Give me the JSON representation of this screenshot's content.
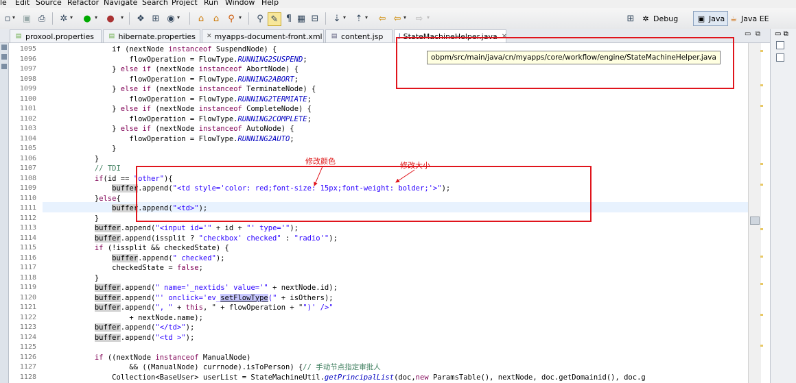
{
  "menu": [
    "le",
    "Edit",
    "Source",
    "Refactor",
    "Navigate",
    "Search",
    "Project",
    "Run",
    "Window",
    "Help"
  ],
  "perspectives": [
    {
      "label": "Debug",
      "icon": "debug-perspective-icon",
      "active": false
    },
    {
      "label": "Java",
      "icon": "java-perspective-icon",
      "active": true
    },
    {
      "label": "Java EE",
      "icon": "javaee-perspective-icon",
      "active": false
    }
  ],
  "tabs": [
    {
      "label": "proxool.properties",
      "icon": "properties-file-icon",
      "active": false
    },
    {
      "label": "hibernate.properties",
      "icon": "properties-file-icon",
      "active": false
    },
    {
      "label": "myapps-document-front.xml",
      "icon": "xml-file-icon",
      "active": false
    },
    {
      "label": "content.jsp",
      "icon": "jsp-file-icon",
      "active": false
    },
    {
      "label": "StateMachineHelper.java",
      "icon": "java-file-icon",
      "active": true
    }
  ],
  "tooltip": "obpm/src/main/java/cn/myapps/core/workflow/engine/StateMachineHelper.java",
  "annotations": {
    "color_note": "修改颜色",
    "size_note": "修改大小"
  },
  "code": {
    "lines": [
      {
        "num": "1095",
        "parts": [
          {
            "t": "                if (nextNode ",
            "c": ""
          },
          {
            "t": "instanceof",
            "c": "kw"
          },
          {
            "t": " SuspendNode) {",
            "c": ""
          }
        ]
      },
      {
        "num": "1096",
        "parts": [
          {
            "t": "                    flowOperation = FlowType.",
            "c": ""
          },
          {
            "t": "RUNNING2SUSPEND",
            "c": "const"
          },
          {
            "t": ";",
            "c": ""
          }
        ]
      },
      {
        "num": "1097",
        "parts": [
          {
            "t": "                } ",
            "c": ""
          },
          {
            "t": "else",
            "c": "kw"
          },
          {
            "t": " ",
            "c": ""
          },
          {
            "t": "if",
            "c": "kw"
          },
          {
            "t": " (nextNode ",
            "c": ""
          },
          {
            "t": "instanceof",
            "c": "kw"
          },
          {
            "t": " AbortNode) {",
            "c": ""
          }
        ]
      },
      {
        "num": "1098",
        "parts": [
          {
            "t": "                    flowOperation = FlowType.",
            "c": ""
          },
          {
            "t": "RUNNING2ABORT",
            "c": "const"
          },
          {
            "t": ";",
            "c": ""
          }
        ]
      },
      {
        "num": "1099",
        "parts": [
          {
            "t": "                } ",
            "c": ""
          },
          {
            "t": "else",
            "c": "kw"
          },
          {
            "t": " ",
            "c": ""
          },
          {
            "t": "if",
            "c": "kw"
          },
          {
            "t": " (nextNode ",
            "c": ""
          },
          {
            "t": "instanceof",
            "c": "kw"
          },
          {
            "t": " TerminateNode) {",
            "c": ""
          }
        ]
      },
      {
        "num": "1100",
        "parts": [
          {
            "t": "                    flowOperation = FlowType.",
            "c": ""
          },
          {
            "t": "RUNNING2TERMIATE",
            "c": "const"
          },
          {
            "t": ";",
            "c": ""
          }
        ]
      },
      {
        "num": "1101",
        "parts": [
          {
            "t": "                } ",
            "c": ""
          },
          {
            "t": "else",
            "c": "kw"
          },
          {
            "t": " ",
            "c": ""
          },
          {
            "t": "if",
            "c": "kw"
          },
          {
            "t": " (nextNode ",
            "c": ""
          },
          {
            "t": "instanceof",
            "c": "kw"
          },
          {
            "t": " CompleteNode) {",
            "c": ""
          }
        ]
      },
      {
        "num": "1102",
        "parts": [
          {
            "t": "                    flowOperation = FlowType.",
            "c": ""
          },
          {
            "t": "RUNNING2COMPLETE",
            "c": "const"
          },
          {
            "t": ";",
            "c": ""
          }
        ]
      },
      {
        "num": "1103",
        "parts": [
          {
            "t": "                } ",
            "c": ""
          },
          {
            "t": "else",
            "c": "kw"
          },
          {
            "t": " ",
            "c": ""
          },
          {
            "t": "if",
            "c": "kw"
          },
          {
            "t": " (nextNode ",
            "c": ""
          },
          {
            "t": "instanceof",
            "c": "kw"
          },
          {
            "t": " AutoNode) {",
            "c": ""
          }
        ]
      },
      {
        "num": "1104",
        "parts": [
          {
            "t": "                    flowOperation = FlowType.",
            "c": ""
          },
          {
            "t": "RUNNING2AUTO",
            "c": "const"
          },
          {
            "t": ";",
            "c": ""
          }
        ]
      },
      {
        "num": "1105",
        "parts": [
          {
            "t": "                }",
            "c": ""
          }
        ]
      },
      {
        "num": "1106",
        "parts": [
          {
            "t": "            }",
            "c": ""
          }
        ]
      },
      {
        "num": "1107",
        "parts": [
          {
            "t": "            ",
            "c": ""
          },
          {
            "t": "// TDI",
            "c": "cmt"
          }
        ]
      },
      {
        "num": "1108",
        "parts": [
          {
            "t": "            ",
            "c": ""
          },
          {
            "t": "if",
            "c": "kw"
          },
          {
            "t": "(id == ",
            "c": ""
          },
          {
            "t": "\"other\"",
            "c": "str"
          },
          {
            "t": "){",
            "c": ""
          }
        ]
      },
      {
        "num": "1109",
        "parts": [
          {
            "t": "                ",
            "c": ""
          },
          {
            "t": "buffer",
            "c": "occ"
          },
          {
            "t": ".append(",
            "c": ""
          },
          {
            "t": "\"<td style='color: red;font-size: 15px;font-weight: bolder;'>\"",
            "c": "str"
          },
          {
            "t": ");",
            "c": ""
          }
        ]
      },
      {
        "num": "1110",
        "parts": [
          {
            "t": "            }",
            "c": ""
          },
          {
            "t": "else",
            "c": "kw"
          },
          {
            "t": "{",
            "c": ""
          }
        ]
      },
      {
        "num": "1111",
        "parts": [
          {
            "t": "                ",
            "c": ""
          },
          {
            "t": "buffer",
            "c": "occ"
          },
          {
            "t": ".append(",
            "c": ""
          },
          {
            "t": "\"<td>\"",
            "c": "str"
          },
          {
            "t": ");",
            "c": ""
          }
        ]
      },
      {
        "num": "1112",
        "parts": [
          {
            "t": "            }",
            "c": ""
          }
        ]
      },
      {
        "num": "1113",
        "parts": [
          {
            "t": "            ",
            "c": ""
          },
          {
            "t": "buffer",
            "c": "occ"
          },
          {
            "t": ".append(",
            "c": ""
          },
          {
            "t": "\"<input id='\"",
            "c": "str"
          },
          {
            "t": " + id + ",
            "c": ""
          },
          {
            "t": "\"' type='\"",
            "c": "str"
          },
          {
            "t": ");",
            "c": ""
          }
        ]
      },
      {
        "num": "1114",
        "parts": [
          {
            "t": "            ",
            "c": ""
          },
          {
            "t": "buffer",
            "c": "occ"
          },
          {
            "t": ".append(issplit ? ",
            "c": ""
          },
          {
            "t": "\"checkbox' checked\"",
            "c": "str"
          },
          {
            "t": " : ",
            "c": ""
          },
          {
            "t": "\"radio'\"",
            "c": "str"
          },
          {
            "t": ");",
            "c": ""
          }
        ]
      },
      {
        "num": "1115",
        "parts": [
          {
            "t": "            ",
            "c": ""
          },
          {
            "t": "if",
            "c": "kw"
          },
          {
            "t": " (!issplit && checkedState) {",
            "c": ""
          }
        ]
      },
      {
        "num": "1116",
        "parts": [
          {
            "t": "                ",
            "c": ""
          },
          {
            "t": "buffer",
            "c": "occ"
          },
          {
            "t": ".append(",
            "c": ""
          },
          {
            "t": "\" checked\"",
            "c": "str"
          },
          {
            "t": ");",
            "c": ""
          }
        ]
      },
      {
        "num": "1117",
        "parts": [
          {
            "t": "                checkedState = ",
            "c": ""
          },
          {
            "t": "false",
            "c": "kw"
          },
          {
            "t": ";",
            "c": ""
          }
        ]
      },
      {
        "num": "1118",
        "parts": [
          {
            "t": "            }",
            "c": ""
          }
        ]
      },
      {
        "num": "1119",
        "parts": [
          {
            "t": "            ",
            "c": ""
          },
          {
            "t": "buffer",
            "c": "occ"
          },
          {
            "t": ".append(",
            "c": ""
          },
          {
            "t": "\" name='_nextids' value='\"",
            "c": "str"
          },
          {
            "t": " + nextNode.id);",
            "c": ""
          }
        ]
      },
      {
        "num": "1120",
        "parts": [
          {
            "t": "            ",
            "c": ""
          },
          {
            "t": "buffer",
            "c": "occ"
          },
          {
            "t": ".append(",
            "c": ""
          },
          {
            "t": "\"' onclick='ev_",
            "c": "str"
          },
          {
            "t": "setFlowType",
            "c": "sel"
          },
          {
            "t": "(\"",
            "c": "str"
          },
          {
            "t": " + isOthers);",
            "c": ""
          }
        ]
      },
      {
        "num": "1121",
        "parts": [
          {
            "t": "            ",
            "c": ""
          },
          {
            "t": "buffer",
            "c": "occ"
          },
          {
            "t": ".append(",
            "c": ""
          },
          {
            "t": "\", \"",
            "c": "str"
          },
          {
            "t": " + ",
            "c": ""
          },
          {
            "t": "this",
            "c": "kw"
          },
          {
            "t": ", ",
            "c": ""
          },
          {
            "t": "\" + flowOperation + \"",
            "c": ""
          },
          {
            "t": "\")' />\"",
            "c": "str"
          }
        ]
      },
      {
        "num": "1122",
        "parts": [
          {
            "t": "                    + nextNode.name);",
            "c": ""
          }
        ]
      },
      {
        "num": "1123",
        "parts": [
          {
            "t": "            ",
            "c": ""
          },
          {
            "t": "buffer",
            "c": "occ"
          },
          {
            "t": ".append(",
            "c": ""
          },
          {
            "t": "\"</td>\"",
            "c": "str"
          },
          {
            "t": ");",
            "c": ""
          }
        ]
      },
      {
        "num": "1124",
        "parts": [
          {
            "t": "            ",
            "c": ""
          },
          {
            "t": "buffer",
            "c": "occ"
          },
          {
            "t": ".append(",
            "c": ""
          },
          {
            "t": "\"<td >\"",
            "c": "str"
          },
          {
            "t": ");",
            "c": ""
          }
        ]
      },
      {
        "num": "1125",
        "parts": [
          {
            "t": "",
            "c": ""
          }
        ]
      },
      {
        "num": "1126",
        "parts": [
          {
            "t": "            ",
            "c": ""
          },
          {
            "t": "if",
            "c": "kw"
          },
          {
            "t": " ((nextNode ",
            "c": ""
          },
          {
            "t": "instanceof",
            "c": "kw"
          },
          {
            "t": " ManualNode)",
            "c": ""
          }
        ]
      },
      {
        "num": "1127",
        "parts": [
          {
            "t": "                    && ((ManualNode) currnode).isToPerson) {",
            "c": ""
          },
          {
            "t": "// 手动节点指定审批人",
            "c": "cmt"
          }
        ]
      },
      {
        "num": "1128",
        "parts": [
          {
            "t": "                Collection<BaseUser> userList = StateMachineUtil.",
            "c": ""
          },
          {
            "t": "getPrincipalList",
            "c": "const"
          },
          {
            "t": "(doc,",
            "c": ""
          },
          {
            "t": "new",
            "c": "kw"
          },
          {
            "t": " ParamsTable(), nextNode, doc.getDomainid(), doc.g",
            "c": ""
          }
        ]
      }
    ]
  }
}
